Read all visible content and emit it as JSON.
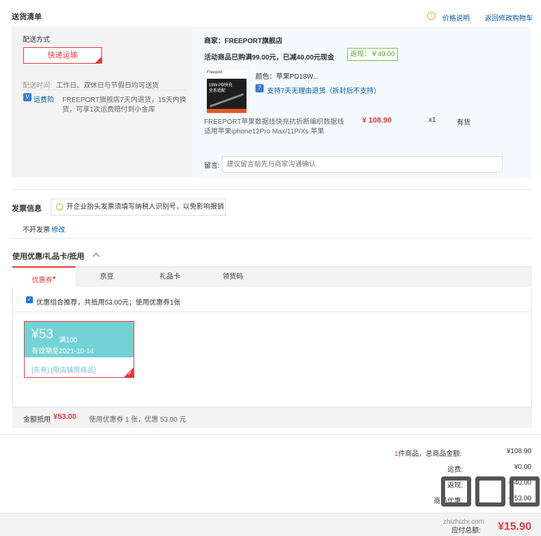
{
  "section_title": "送货清单",
  "header_links": {
    "price_info": "价格说明",
    "back_to_cart": "返回修改购物车"
  },
  "delivery": {
    "method_label": "配送方式",
    "method_value": "快递运输",
    "time_label": "配送时间:",
    "time_value": "工作日、双休日与节假日均可送货",
    "insurance_label": "运费险",
    "insurance_text_1": "FREEPORT旗舰店7天内退货，15天内换",
    "insurance_text_2": "货，可享1次运费赔付到小金库"
  },
  "shop": {
    "name": "商家：FREEPORT旗舰店",
    "promo": "活动商品已购满99.00元，已减40.00元现金",
    "fanxian": "返现：￥40.00"
  },
  "product": {
    "image_logo": "Freeport",
    "image_text_1": "18W PD快充",
    "image_text_2": "全系适配",
    "color": "颜色：苹果PD18W...",
    "return_policy": "支持7天无理由退货（拆封后不支持）",
    "name_1": "FREEPORT苹果数据线快充抗折断编织数据线",
    "name_2": "适用苹果iphone12Pro Max/11P/Xs 苹果",
    "price": "¥ 108.90",
    "qty": "x1",
    "stock": "有货"
  },
  "message": {
    "label": "留言:",
    "placeholder": "建议留言前先与商家沟通确认"
  },
  "invoice": {
    "label": "发票信息",
    "tip": "开企业抬头发票须填写纳税人识别号，以免影响报销",
    "status": "不开发票",
    "edit": "修改"
  },
  "discount": {
    "title": "使用优惠/礼品卡/抵用",
    "tabs": [
      "优惠券",
      "京豆",
      "礼品卡",
      "领货码"
    ],
    "recommend": "优惠组合推荐，共抵用53.00元；使用优惠券1张",
    "coupon": {
      "amount": "¥53",
      "condition": "满100",
      "expiry": "有效期至2021-10-14",
      "tags": "[东券] [限店铺限商品]"
    },
    "summary_label": "金额抵用",
    "summary_amount": "¥53.00",
    "summary_text": "使用优惠券 1 张，优惠 53.00 元"
  },
  "totals": {
    "count": "1",
    "goods_label": "件商品，总商品金额:",
    "goods_value": "¥108.90",
    "freight_label": "运费:",
    "freight_value": "¥0.00",
    "cashback_label": "返现:",
    "cashback_value": "-¥40.00",
    "coupon_label": "商品优惠:",
    "coupon_value": "-¥53.00",
    "payable_label": "应付总额:",
    "payable_value": "¥15.90"
  },
  "watermark": "zhizhizhi.com",
  "colors": {
    "accent": "#e4393c",
    "link": "#005aa0",
    "coupon": "#74d2d6",
    "green": "#52a22a"
  }
}
